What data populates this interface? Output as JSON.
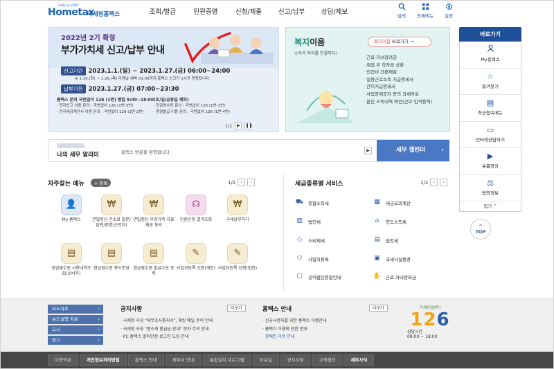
{
  "header": {
    "logo_main": "Hometax",
    "logo_sub": "국세청홈택스",
    "logo_tiny": "국세청 실시간정보",
    "nav": [
      "조회/발급",
      "민원증명",
      "신청/제출",
      "신고/납부",
      "상담/제보"
    ],
    "util": [
      {
        "label": "검색",
        "icon": "search-icon"
      },
      {
        "label": "전체메뉴",
        "icon": "menu-icon"
      },
      {
        "label": "설정",
        "icon": "gear-icon"
      }
    ]
  },
  "banner": {
    "subtitle": "2022년 2기 확정",
    "title": "부가가치세 신고/납부 안내",
    "period_tag": "신고기간",
    "period_value": "2023.1.1.(일) ~ 2023.1.27.(금) 06:00~24:00",
    "period_note": "※ 1.10.(화) ~ 1.26.(목) 다음날 새벽 01:00까지 홈택스 신고가 1시간 연장됩니다.",
    "deadline_tag": "납부기한",
    "deadline_value": "2023.1.27.(금) 07:00~23:30",
    "info_main": "홈택스 문의 국번없이 126 (1번) 평일 9:00~18:00(토/일/공휴일 제외)",
    "info_lines": [
      "· 전자신고 이용 문의 : 국번없이 126 (1번-3번)",
      "· 현금영수증 문의 : 국번없이 126 (1번-1번)",
      "· 전자세금계산서 이용 문의 : 국번없이 126 (1번-2번)",
      "· 증명발급 이용 문의 : 국번없이 126 (1번-4번)"
    ],
    "pager": "1/1"
  },
  "welfare": {
    "title_hl": "복지",
    "title_rest": "이음",
    "desc": "소득과 복지를 연결하다!",
    "btn_hl": "복지이음",
    "btn_rest": " 바로가기",
    "items": [
      "근로·자녀장려금",
      "취업 후 학자금 상환",
      "인건비 간편제출",
      "일용근로소득 지급명세서",
      "간이지급명세서",
      "사업장제공자 등의 과세자료",
      "본인 소득내역 확인(근로·인적용역)"
    ]
  },
  "quick": {
    "title": "바로가기",
    "items": [
      {
        "label": "My홈택스",
        "icon": "user-icon"
      },
      {
        "label": "즐겨찾기",
        "icon": "star-icon"
      },
      {
        "label": "최근접속메뉴",
        "icon": "history-icon"
      },
      {
        "label": "인터넷상담하기",
        "icon": "chat-icon"
      },
      {
        "label": "숏폼영상",
        "icon": "play-icon"
      },
      {
        "label": "법령정보",
        "icon": "gavel-icon"
      }
    ],
    "fold": "접기 ^",
    "top": "TOP"
  },
  "notice": {
    "title": "나의 세무 알리미",
    "text": "홈택스 방문을 환영합니다.",
    "calendar": "세무 캘린더"
  },
  "frequent": {
    "title": "자주찾는 메뉴",
    "register": "+ 등록",
    "page": "1/2",
    "items": [
      {
        "label": "My 홈택스",
        "icon": "user-icon",
        "tone": "blue"
      },
      {
        "label": "연말정산 간소화 질문/답변/증명(근로자)",
        "icon": "money-bag-icon",
        "tone": "gold"
      },
      {
        "label": "연말정산 부양가족 자료제공 동의",
        "icon": "money-bag-icon",
        "tone": "gold"
      },
      {
        "label": "민원신청 결과조회",
        "icon": "headset-icon",
        "tone": "pink"
      },
      {
        "label": "국세납부하기",
        "icon": "money-bag-icon",
        "tone": "gold"
      },
      {
        "label": "현금영수증 사용내역조회(소비자)",
        "icon": "receipt-icon",
        "tone": "gold"
      },
      {
        "label": "현금영수증 용도변경",
        "icon": "receipt-icon",
        "tone": "gold"
      },
      {
        "label": "현금영수증 발급수단 등록",
        "icon": "receipt-icon",
        "tone": "gold"
      },
      {
        "label": "사업자등록 신청(개인)",
        "icon": "document-icon",
        "tone": "gold"
      },
      {
        "label": "사업자등록 신청(법인)",
        "icon": "document-icon",
        "tone": "gold"
      }
    ]
  },
  "taxsvc": {
    "title": "세금종류별 서비스",
    "page": "1/2",
    "items": [
      {
        "label": "종합소득세",
        "icon": "car-icon"
      },
      {
        "label": "세금모의계산",
        "icon": "calculator-icon"
      },
      {
        "label": "법인세",
        "icon": "building-icon"
      },
      {
        "label": "양도소득세",
        "icon": "house-icon"
      },
      {
        "label": "소비제세",
        "icon": "diamond-icon"
      },
      {
        "label": "원천세",
        "icon": "receipt-icon"
      },
      {
        "label": "사업자등록",
        "icon": "person-icon"
      },
      {
        "label": "국세사실증명",
        "icon": "certificate-icon"
      },
      {
        "label": "공익법인종합안내",
        "icon": "clipboard-icon"
      },
      {
        "label": "근로·자녀장려금",
        "icon": "handshake-icon"
      }
    ]
  },
  "footer": {
    "links": [
      "보도자료",
      "보도설명 자료",
      "고시",
      "공고"
    ],
    "notice_title": "공지사항",
    "notice_more": "더보기",
    "notices": [
      "국세청 사칭 \"세무조사통지서\", 해킹 메일 주의 안내",
      "국세청 사칭 \"종소세 환급금 안내\" 문자 주의 안내",
      "PC 홈택스 멀티인증 로그인 도입 안내"
    ],
    "guide_title": "홈택스 안내",
    "guide_more": "더보기",
    "guides": [
      "신규사업자를 위한 홈택스 이용안내",
      "홈택스 이용에 관한 안내",
      "장애인 이용 안내"
    ],
    "cc_top": "국세상담센터",
    "cc_num_a": "12",
    "cc_num_b": "6",
    "cc_bot1": "상담시간",
    "cc_bot2": "09:00 ~ 18:00"
  },
  "bottom": [
    "이용약관",
    "개인정보처리방침",
    "홈택스 안내",
    "세무서 안내",
    "통합설치 프로그램",
    "자료실",
    "공지사항",
    "고객센터",
    "세무사식"
  ]
}
